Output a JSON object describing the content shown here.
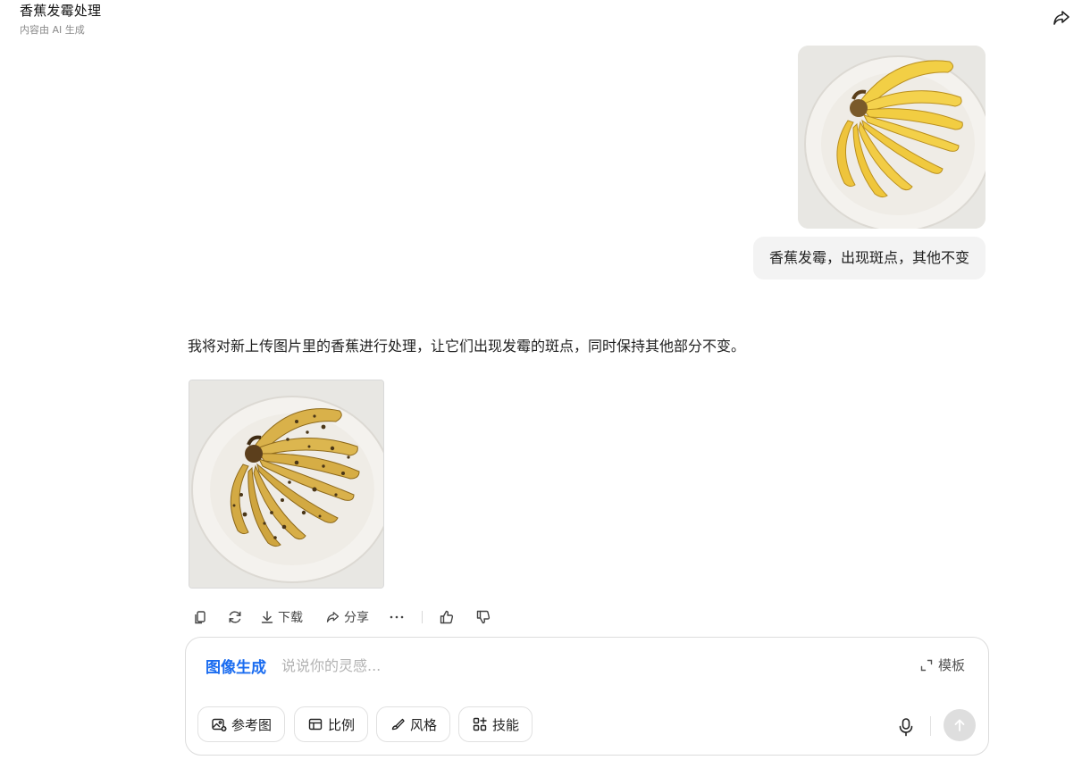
{
  "header": {
    "title": "香蕉发霉处理",
    "subtitle": "内容由 AI 生成",
    "share_icon": "share-icon"
  },
  "conversation": {
    "user_message": "香蕉发霉，出现斑点，其他不变",
    "ai_response": "我将对新上传图片里的香蕉进行处理，让它们出现发霉的斑点，同时保持其他部分不变。"
  },
  "actions": {
    "download_label": "下载",
    "share_label": "分享",
    "icons": [
      "copy-icon",
      "regenerate-icon",
      "download-icon",
      "share-icon",
      "more-icon",
      "thumbs-up-icon",
      "thumbs-down-icon"
    ]
  },
  "composer": {
    "mode_label": "图像生成",
    "placeholder": "说说你的灵感...",
    "template_label": "模板",
    "chips": {
      "reference": "参考图",
      "ratio": "比例",
      "style": "风格",
      "skills": "技能"
    }
  },
  "colors": {
    "accent": "#1a6cf0",
    "bubble": "#f3f3f3",
    "send_disabled": "#dedede"
  }
}
